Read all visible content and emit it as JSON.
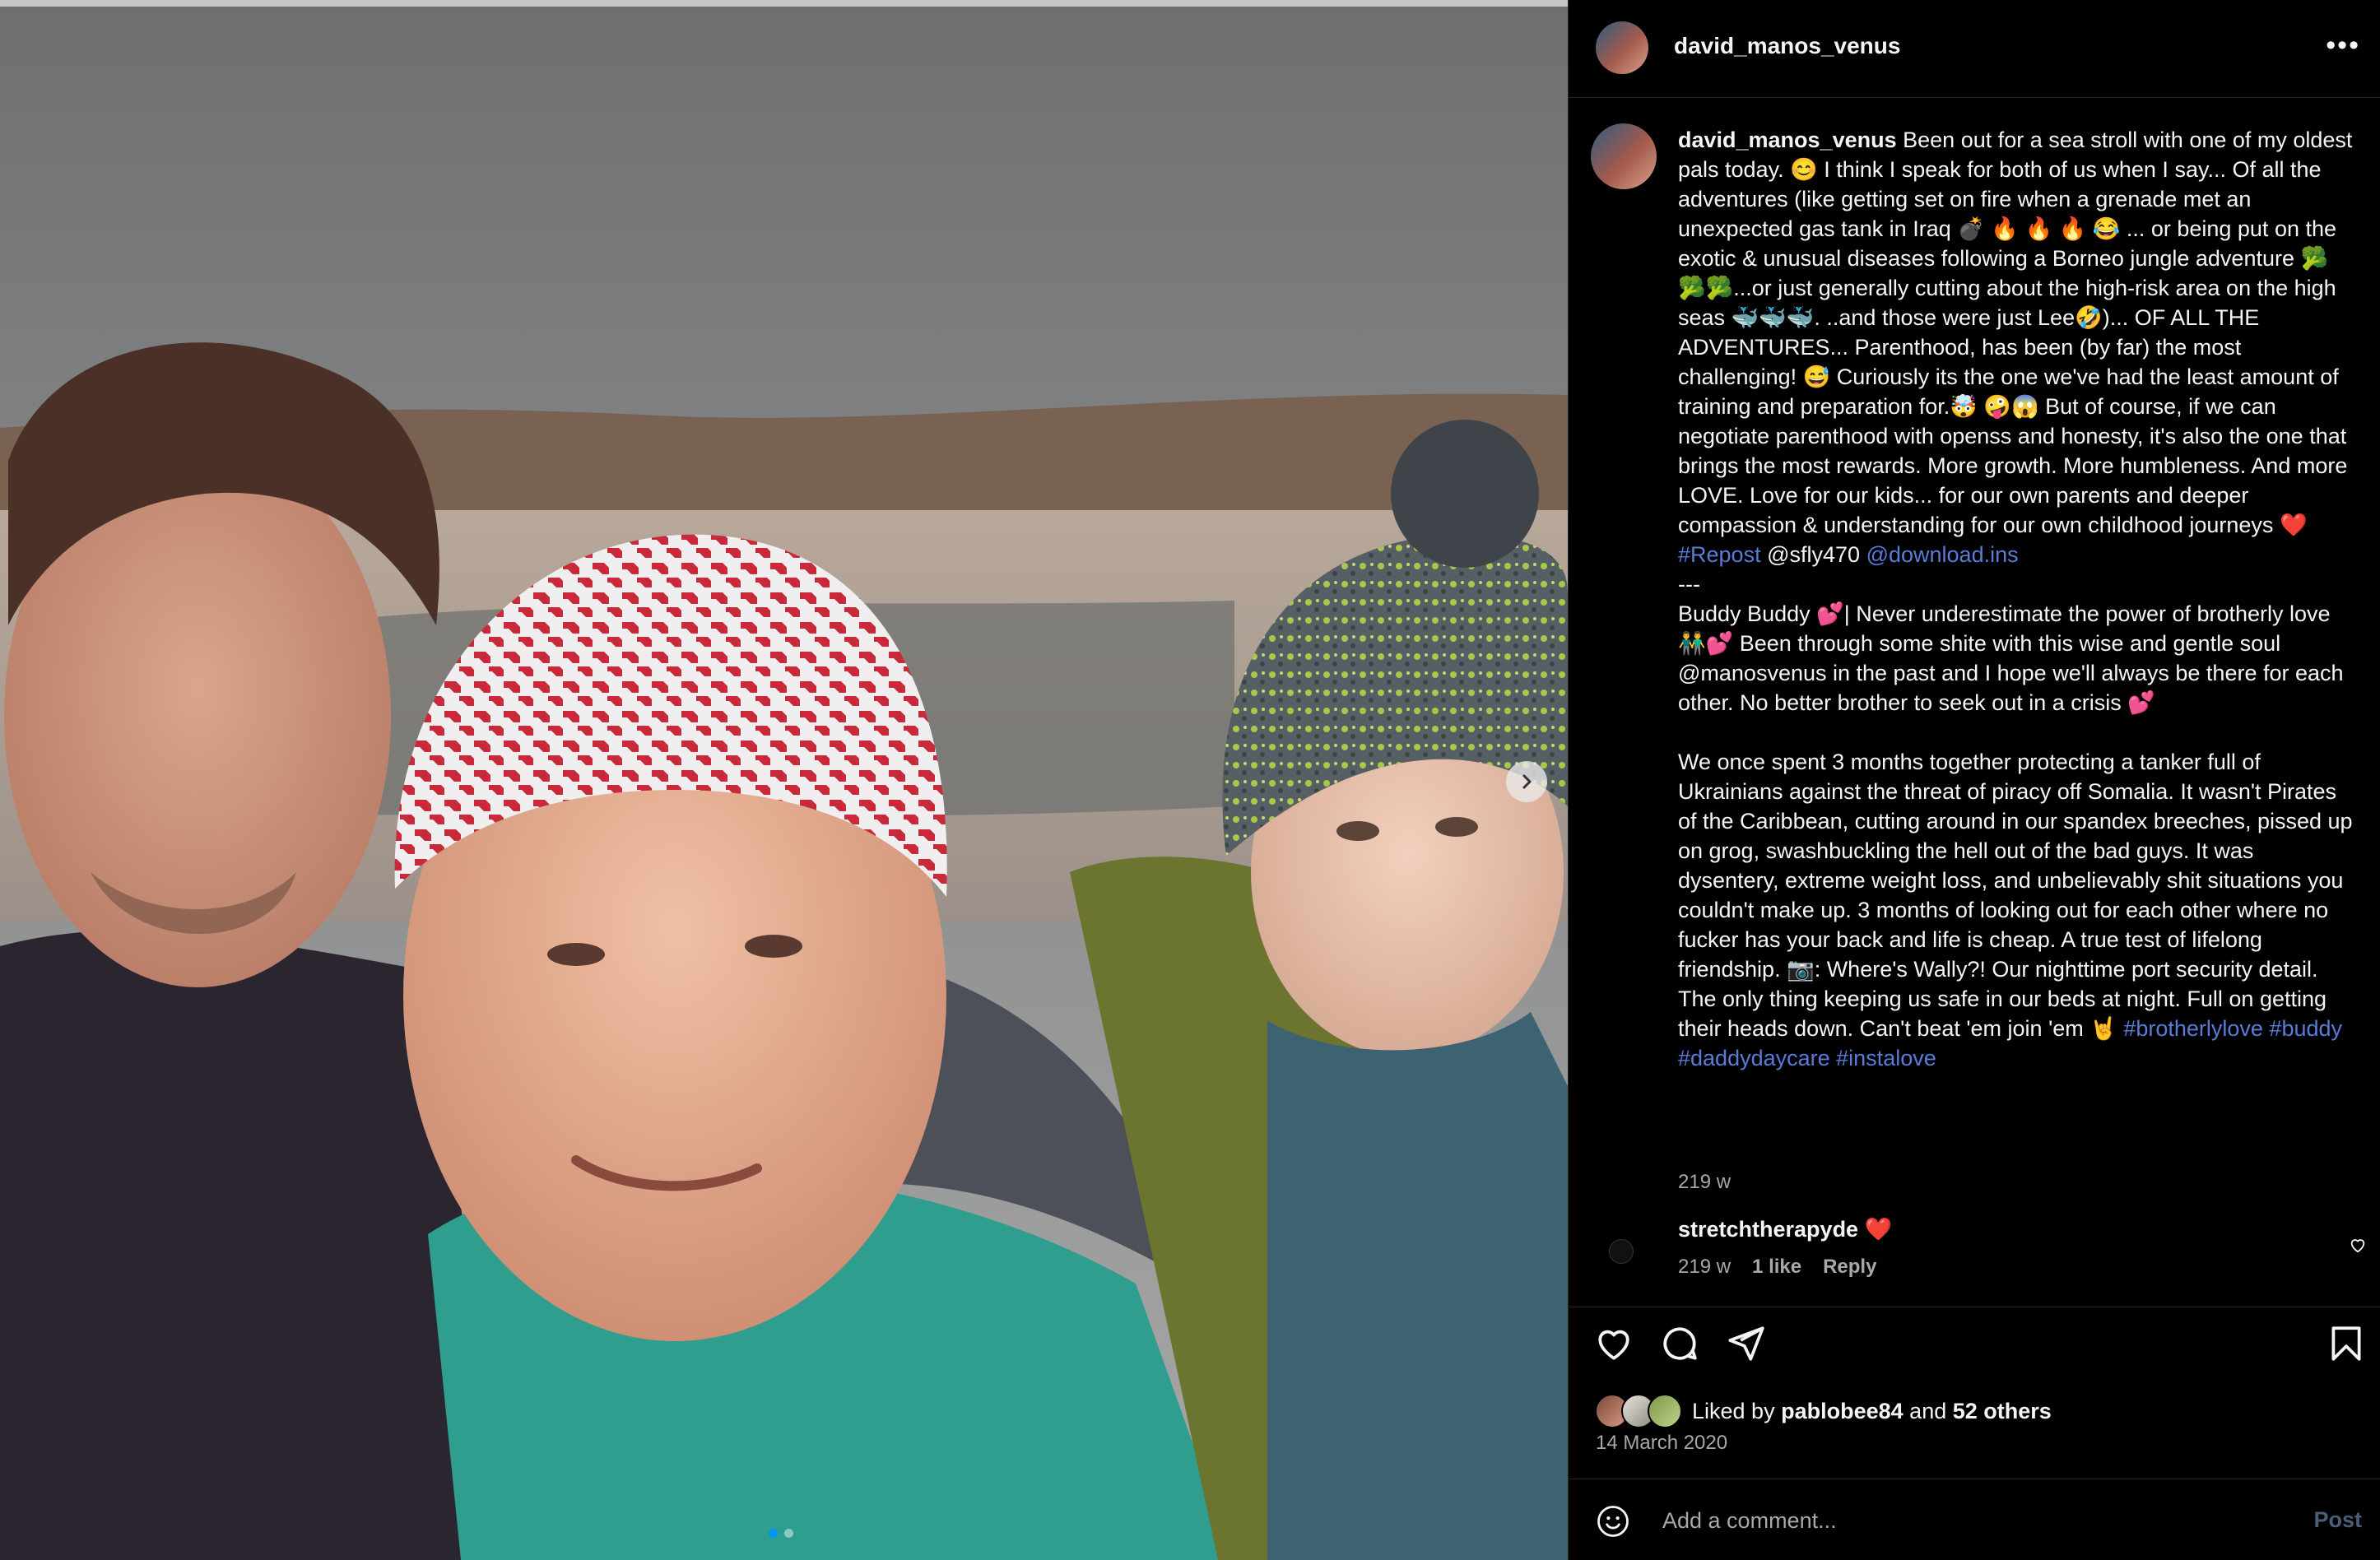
{
  "post": {
    "username": "david_manos_venus",
    "more_icon": "more-options-icon",
    "slide_count": 2,
    "current_slide": 1
  },
  "caption": {
    "username": "david_manos_venus",
    "text_1": "Been out for a sea stroll with one of my oldest pals today. 😊 I think I speak for both of us when I say... Of all the adventures (like getting set on fire when a grenade met an unexpected gas tank in Iraq 💣 🔥 🔥 🔥 😂 ... or being put on the exotic & unusual diseases following a Borneo jungle adventure 🥦🥦🥦...or just generally cutting about the high-risk area on the high seas 🐳🐳🐳. ..and those were just Lee🤣)... OF ALL THE ADVENTURES... Parenthood, has been (by far) the most challenging! 😅 Curiously its the one we've had the least amount of training and preparation for.🤯 🤪😱 But of course, if we can negotiate parenthood with openss and honesty, it's also the one that brings the most rewards. More growth. More humbleness. And more LOVE. Love for our kids... for our own parents and deeper compassion & understanding for our own childhood journeys ❤️ ",
    "hashtag_repost": "#Repost",
    "mention_sfly": "@sfly470",
    "mention_download": "@download.ins",
    "separator": "---",
    "text_2": "Buddy Buddy 💕| Never underestimate the power of brotherly love 👬💕 Been through some shite with this wise and gentle soul @manosvenus in the past and I hope we'll always be there for each other. No better brother to seek out in a crisis 💕",
    "text_3": "We once spent 3 months together protecting a tanker full of Ukrainians against the threat of piracy off Somalia. It wasn't Pirates of the Caribbean, cutting around in our spandex breeches, pissed up on grog, swashbuckling the hell out of the bad guys. It was dysentery, extreme weight loss, and unbelievably shit situations you couldn't make up. 3 months of looking out for each other where no fucker has your back and life is cheap. A true test of lifelong friendship. 📷: Where's Wally?! Our nighttime port security detail. The only thing keeping us safe in our beds at night. Full on getting their heads down. Can't beat 'em join 'em 🤘 ",
    "hashtags": [
      "#brotherlylove",
      "#buddy",
      "#daddydaycare",
      "#instalove"
    ],
    "time": "219 w"
  },
  "comment": {
    "username": "stretchtherapyde",
    "text": "❤️",
    "time": "219 w",
    "likes": "1 like",
    "reply": "Reply"
  },
  "likes": {
    "prefix": "Liked by",
    "user": "pablobee84",
    "and": "and",
    "others": "52 others"
  },
  "date": "14 March 2020",
  "add_comment": {
    "placeholder": "Add a comment...",
    "post_label": "Post"
  },
  "colors": {
    "background": "#000000",
    "text": "#f5f5f5",
    "muted": "#a8a8a8",
    "link": "#5a7bd8",
    "like_red": "#e0245e",
    "post_button_disabled": "#4a5e7a",
    "carousel_dot_active": "#0095f6"
  }
}
